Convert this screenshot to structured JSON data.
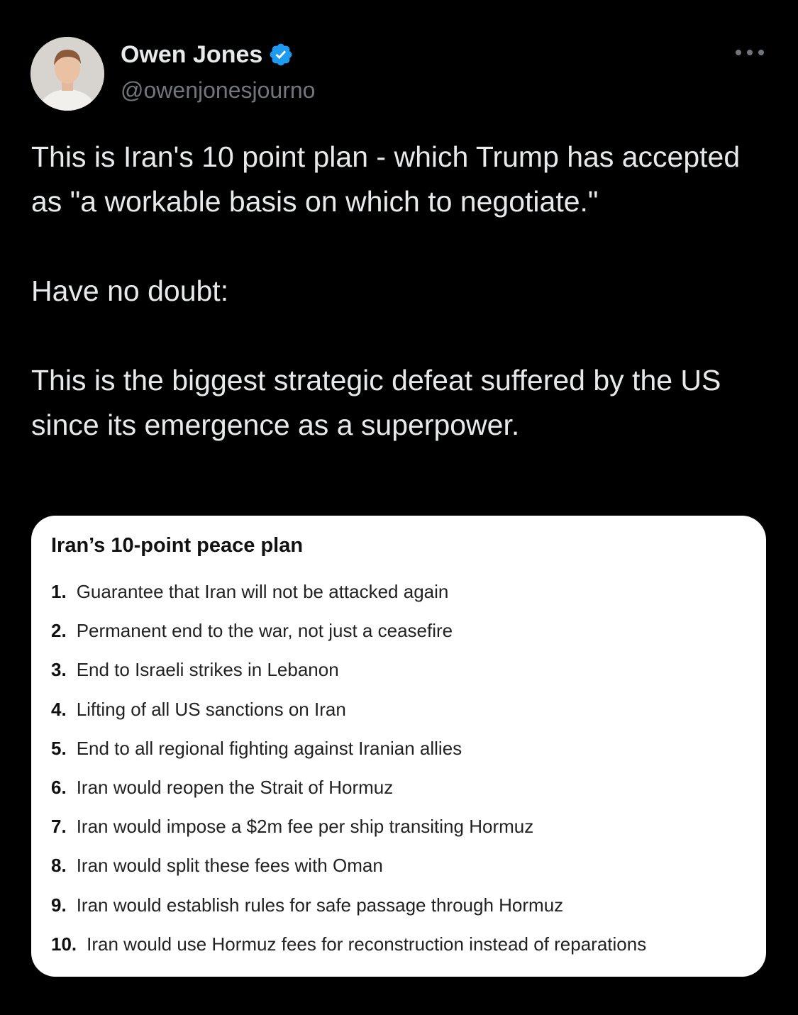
{
  "author": {
    "display_name": "Owen Jones",
    "handle": "@owenjonesjourno",
    "verified": true
  },
  "post": {
    "paragraphs": [
      "This is Iran's 10 point plan - which Trump has accepted as \"a workable basis on which to negotiate.\"",
      "Have no doubt:",
      "This is the biggest strategic defeat suffered by the US since its emergence as a superpower."
    ]
  },
  "card": {
    "title": "Iran’s 10-point peace plan",
    "items": [
      {
        "num": "1.",
        "text": "Guarantee that Iran will not be attacked again"
      },
      {
        "num": "2.",
        "text": "Permanent end to the war, not just a ceasefire"
      },
      {
        "num": "3.",
        "text": "End to Israeli strikes in Lebanon"
      },
      {
        "num": "4.",
        "text": "Lifting of all US sanctions on Iran"
      },
      {
        "num": "5.",
        "text": "End to all regional fighting against Iranian allies"
      },
      {
        "num": "6.",
        "text": "Iran would reopen the Strait of Hormuz"
      },
      {
        "num": "7.",
        "text": "Iran would impose a $2m fee per ship transiting Hormuz"
      },
      {
        "num": "8.",
        "text": "Iran would split these fees with Oman"
      },
      {
        "num": "9.",
        "text": "Iran would establish rules for safe passage through Hormuz"
      },
      {
        "num": "10.",
        "text": "Iran would use Hormuz fees for reconstruction instead of reparations"
      }
    ]
  },
  "icons": {
    "verified": "verified-badge-icon",
    "more": "more-options-icon"
  },
  "colors": {
    "background": "#000000",
    "text_primary": "#e7e9ea",
    "text_secondary": "#71767b",
    "verified_blue": "#1d9bf0",
    "card_background": "#ffffff"
  }
}
